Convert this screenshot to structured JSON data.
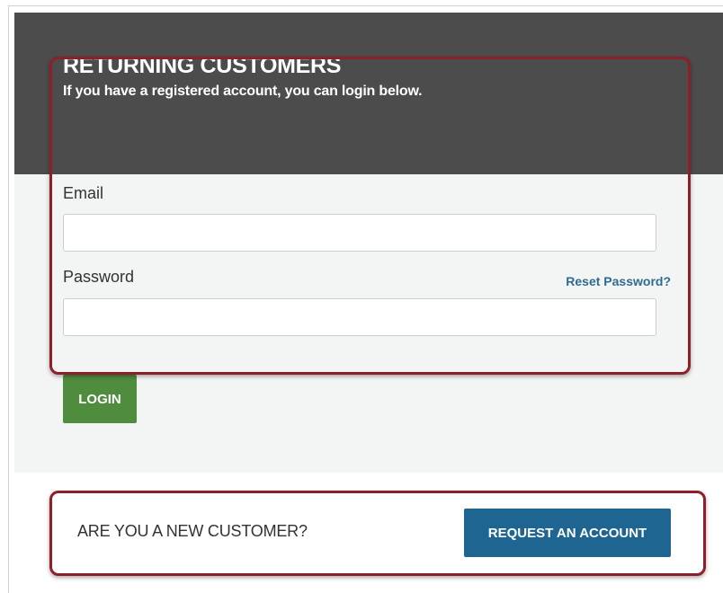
{
  "login": {
    "title": "RETURNING CUSTOMERS",
    "subtitle": "If you have a registered account, you can login below.",
    "email_label": "Email",
    "email_value": "",
    "password_label": "Password",
    "password_value": "",
    "reset_link": "Reset Password?",
    "login_button": "LOGIN"
  },
  "new_customer": {
    "prompt": "ARE YOU A NEW CUSTOMER?",
    "request_button": "REQUEST AN ACCOUNT"
  },
  "colors": {
    "header_bg": "#4b4c4b",
    "card_bg": "#f3f5f4",
    "login_button": "#508c3e",
    "request_button": "#1f6591",
    "link": "#2f6b8f",
    "highlight_border": "#8c1f27"
  }
}
